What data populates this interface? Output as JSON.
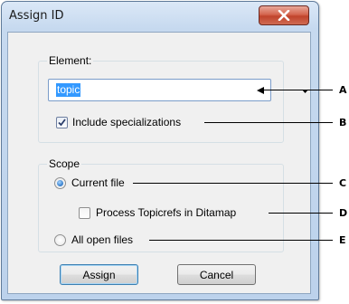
{
  "window": {
    "title": "Assign ID",
    "close_icon": "close-icon"
  },
  "element_group": {
    "label": "Element:",
    "input_value": "topic",
    "include_specializations": {
      "label": "Include specializations",
      "checked": true
    }
  },
  "scope_group": {
    "label": "Scope",
    "current_file": {
      "label": "Current file",
      "selected": true
    },
    "process_topicrefs": {
      "label": "Process Topicrefs in Ditamap",
      "checked": false
    },
    "all_open_files": {
      "label": "All open files",
      "selected": false
    }
  },
  "buttons": {
    "assign": "Assign",
    "cancel": "Cancel"
  },
  "callouts": [
    "A",
    "B",
    "C",
    "D",
    "E"
  ]
}
